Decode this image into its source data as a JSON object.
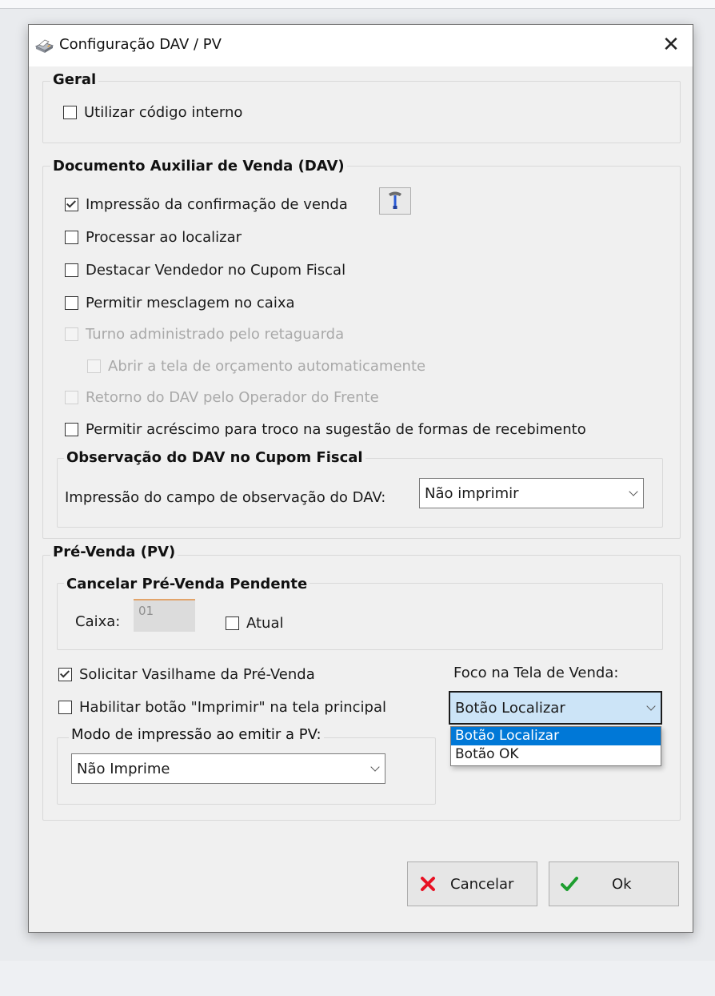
{
  "window": {
    "title": "Configuração DAV / PV",
    "close_icon": "close-icon"
  },
  "geral": {
    "title": "Geral",
    "utilizar_codigo_interno": {
      "label": "Utilizar código interno",
      "checked": false
    }
  },
  "dav": {
    "title": "Documento Auxiliar de Venda (DAV)",
    "impressao_confirmacao": {
      "label": "Impressão da confirmação de venda",
      "checked": true,
      "config_icon": "tool-settings-icon"
    },
    "processar_localizar": {
      "label": "Processar ao localizar",
      "checked": false
    },
    "destacar_vendedor": {
      "label": "Destacar Vendedor no Cupom Fiscal",
      "checked": false
    },
    "permitir_mesclagem": {
      "label": "Permitir mesclagem no caixa",
      "checked": false
    },
    "turno_administrado": {
      "label": "Turno administrado pelo retaguarda",
      "checked": false,
      "enabled": false
    },
    "abrir_tela_orcamento": {
      "label": "Abrir a tela de orçamento automaticamente",
      "checked": false,
      "enabled": false
    },
    "retorno_dav": {
      "label": "Retorno do DAV pelo Operador do Frente",
      "checked": false,
      "enabled": false
    },
    "permitir_acrescimo": {
      "label": "Permitir acréscimo para troco na sugestão de formas de recebimento",
      "checked": false
    },
    "observacao": {
      "title": "Observação do DAV no Cupom Fiscal",
      "label": "Impressão do campo de observação do DAV:",
      "value": "Não imprimir"
    }
  },
  "pv": {
    "title": "Pré-Venda (PV)",
    "cancelar": {
      "title": "Cancelar Pré-Venda Pendente",
      "caixa_label": "Caixa:",
      "caixa_value": "01",
      "atual": {
        "label": "Atual",
        "checked": false
      }
    },
    "solicitar_vasilhame": {
      "label": "Solicitar Vasilhame da Pré-Venda",
      "checked": true
    },
    "habilitar_imprimir": {
      "label": "Habilitar botão \"Imprimir\" na tela principal",
      "checked": false
    },
    "modo_impressao": {
      "label": "Modo de impressão ao emitir a PV:",
      "value": "Não Imprime"
    },
    "foco": {
      "label": "Foco na Tela de Venda:",
      "value": "Botão Localizar",
      "options": [
        "Botão Localizar",
        "Botão OK"
      ],
      "highlighted": "Botão Localizar"
    }
  },
  "buttons": {
    "cancelar": {
      "label": "Cancelar",
      "icon": "cancel-x-icon",
      "icon_color": "#e81123"
    },
    "ok": {
      "label": "Ok",
      "icon": "checkmark-icon",
      "icon_color": "#1e9e2f"
    }
  }
}
